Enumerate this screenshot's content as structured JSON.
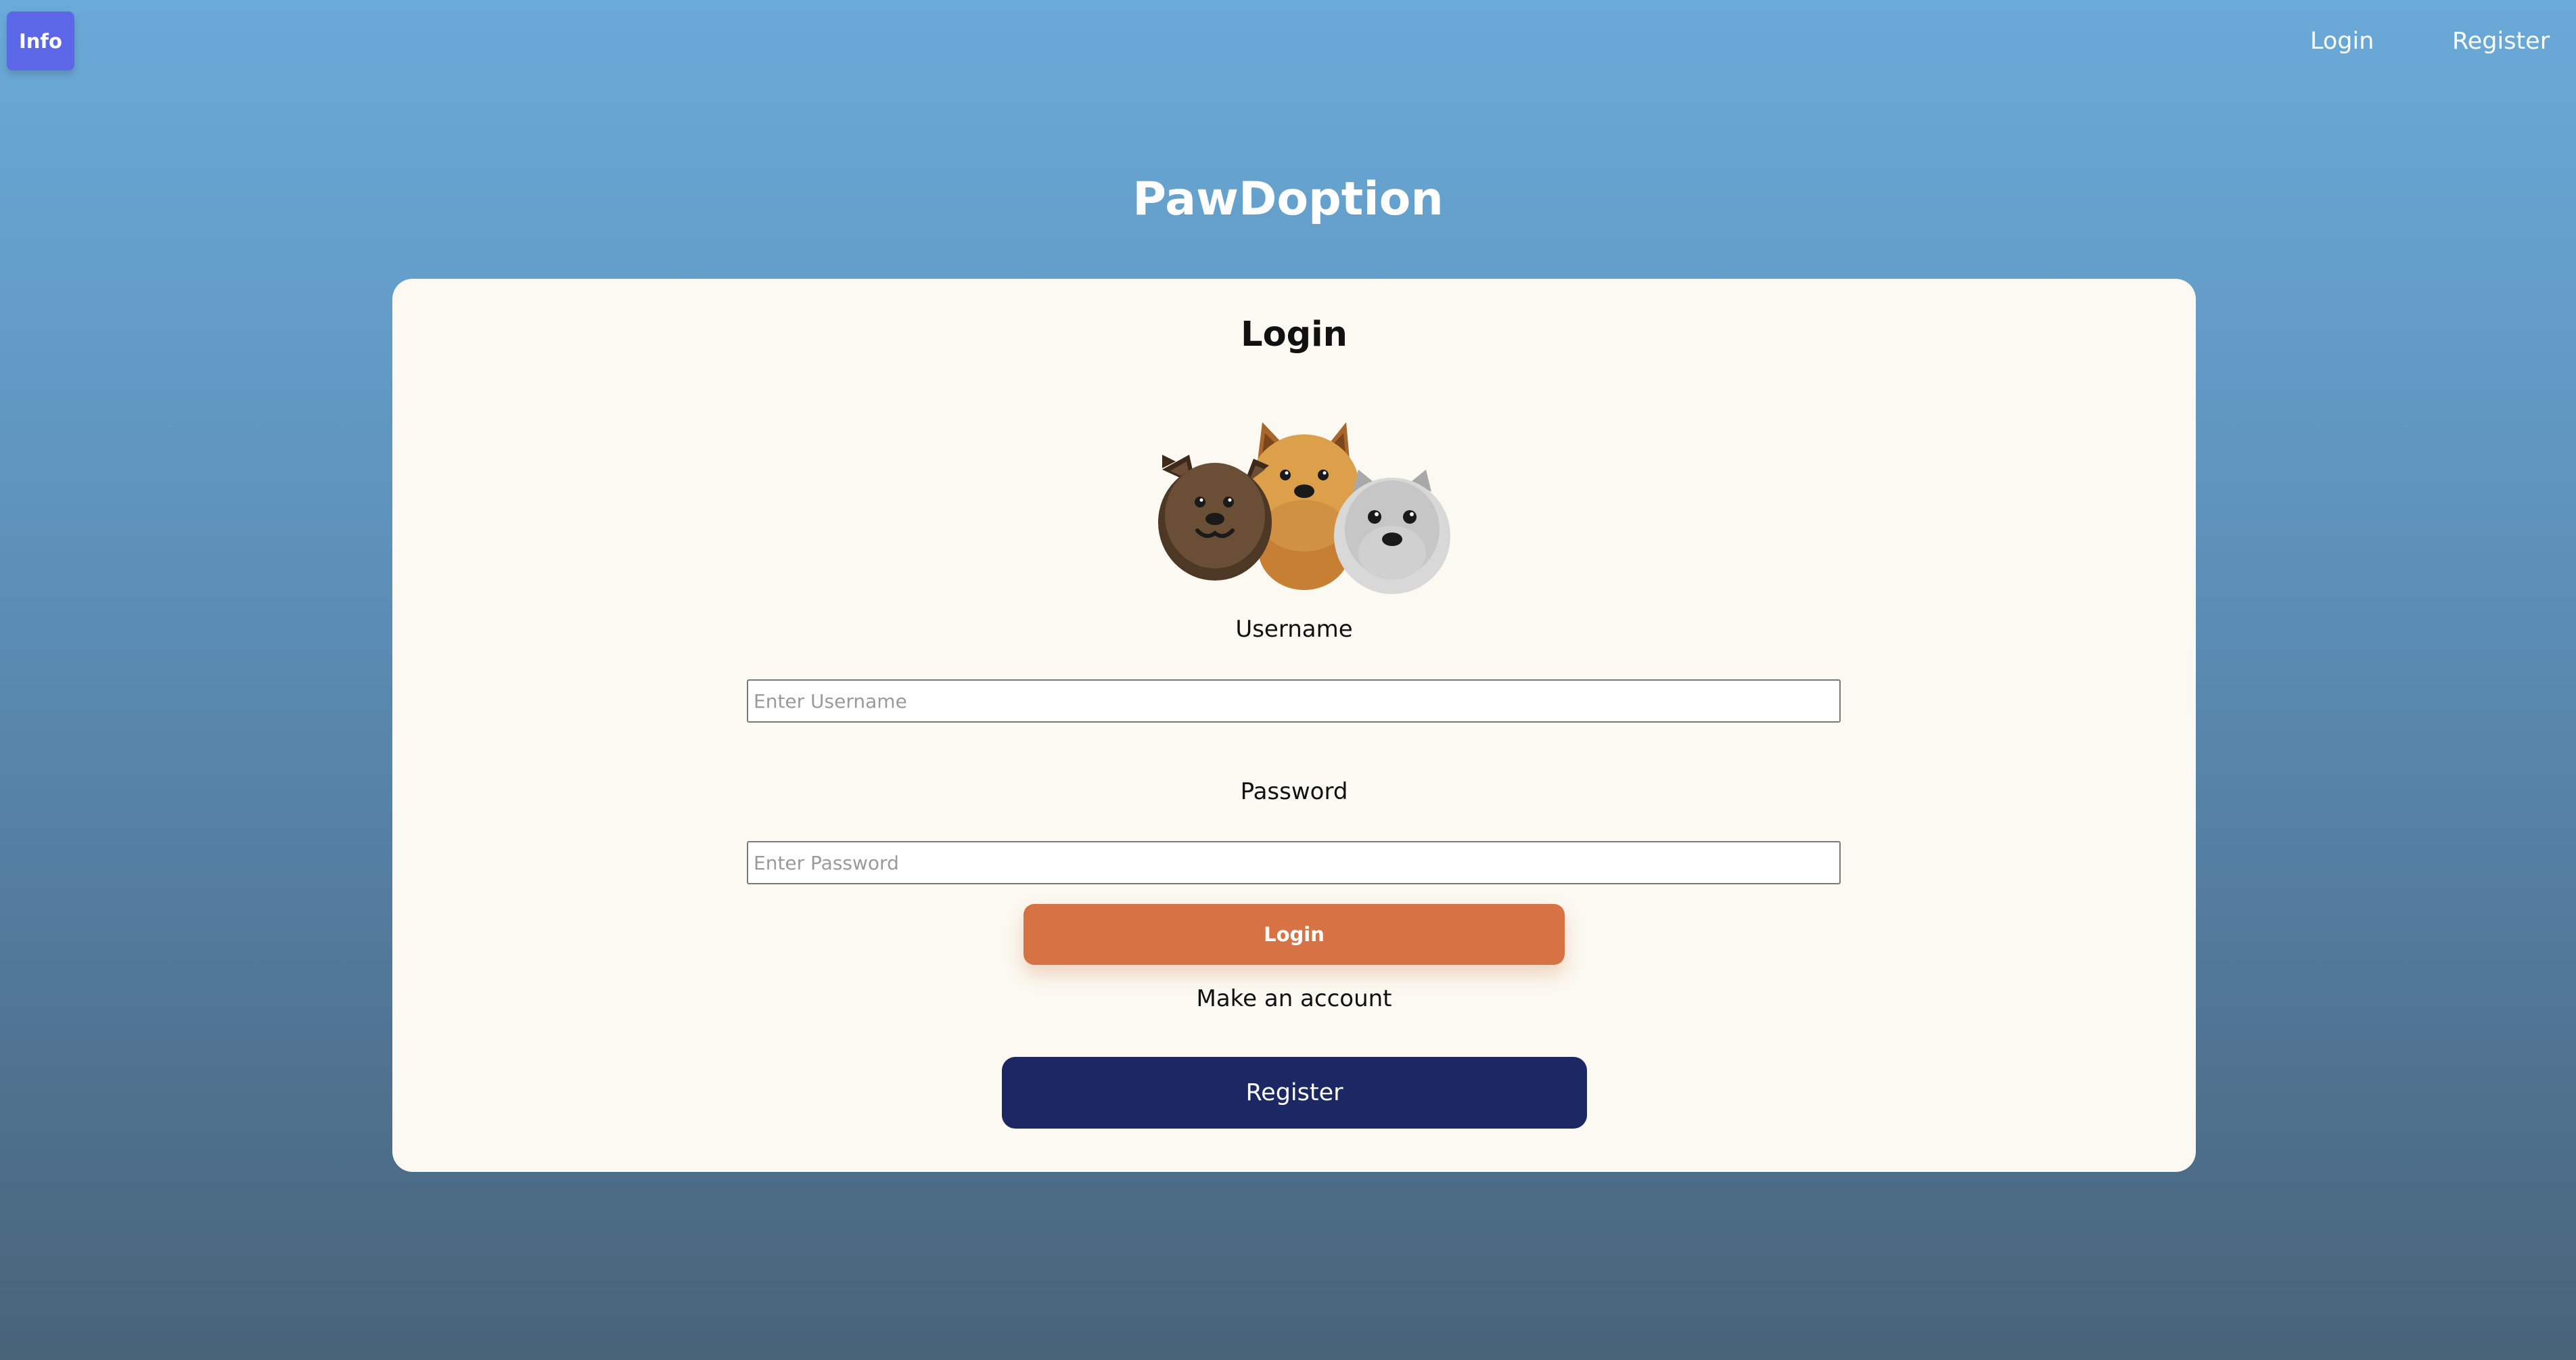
{
  "header": {
    "info_label": "Info",
    "nav": {
      "login": "Login",
      "register": "Register"
    }
  },
  "app": {
    "title": "PawDoption"
  },
  "login_card": {
    "title": "Login",
    "username": {
      "label": "Username",
      "value": "",
      "placeholder": "Enter Username"
    },
    "password": {
      "label": "Password",
      "value": "",
      "placeholder": "Enter Password"
    },
    "login_button": "Login",
    "make_account_text": "Make an account",
    "register_button": "Register"
  },
  "icons": {
    "mascot": "three-dogs-illustration"
  },
  "colors": {
    "background_top": "#6aaad8",
    "background_bottom": "#486378",
    "info_button": "#5b67e6",
    "card": "#fbf9f1",
    "login_button": "#d67244",
    "register_button": "#1b2864"
  }
}
